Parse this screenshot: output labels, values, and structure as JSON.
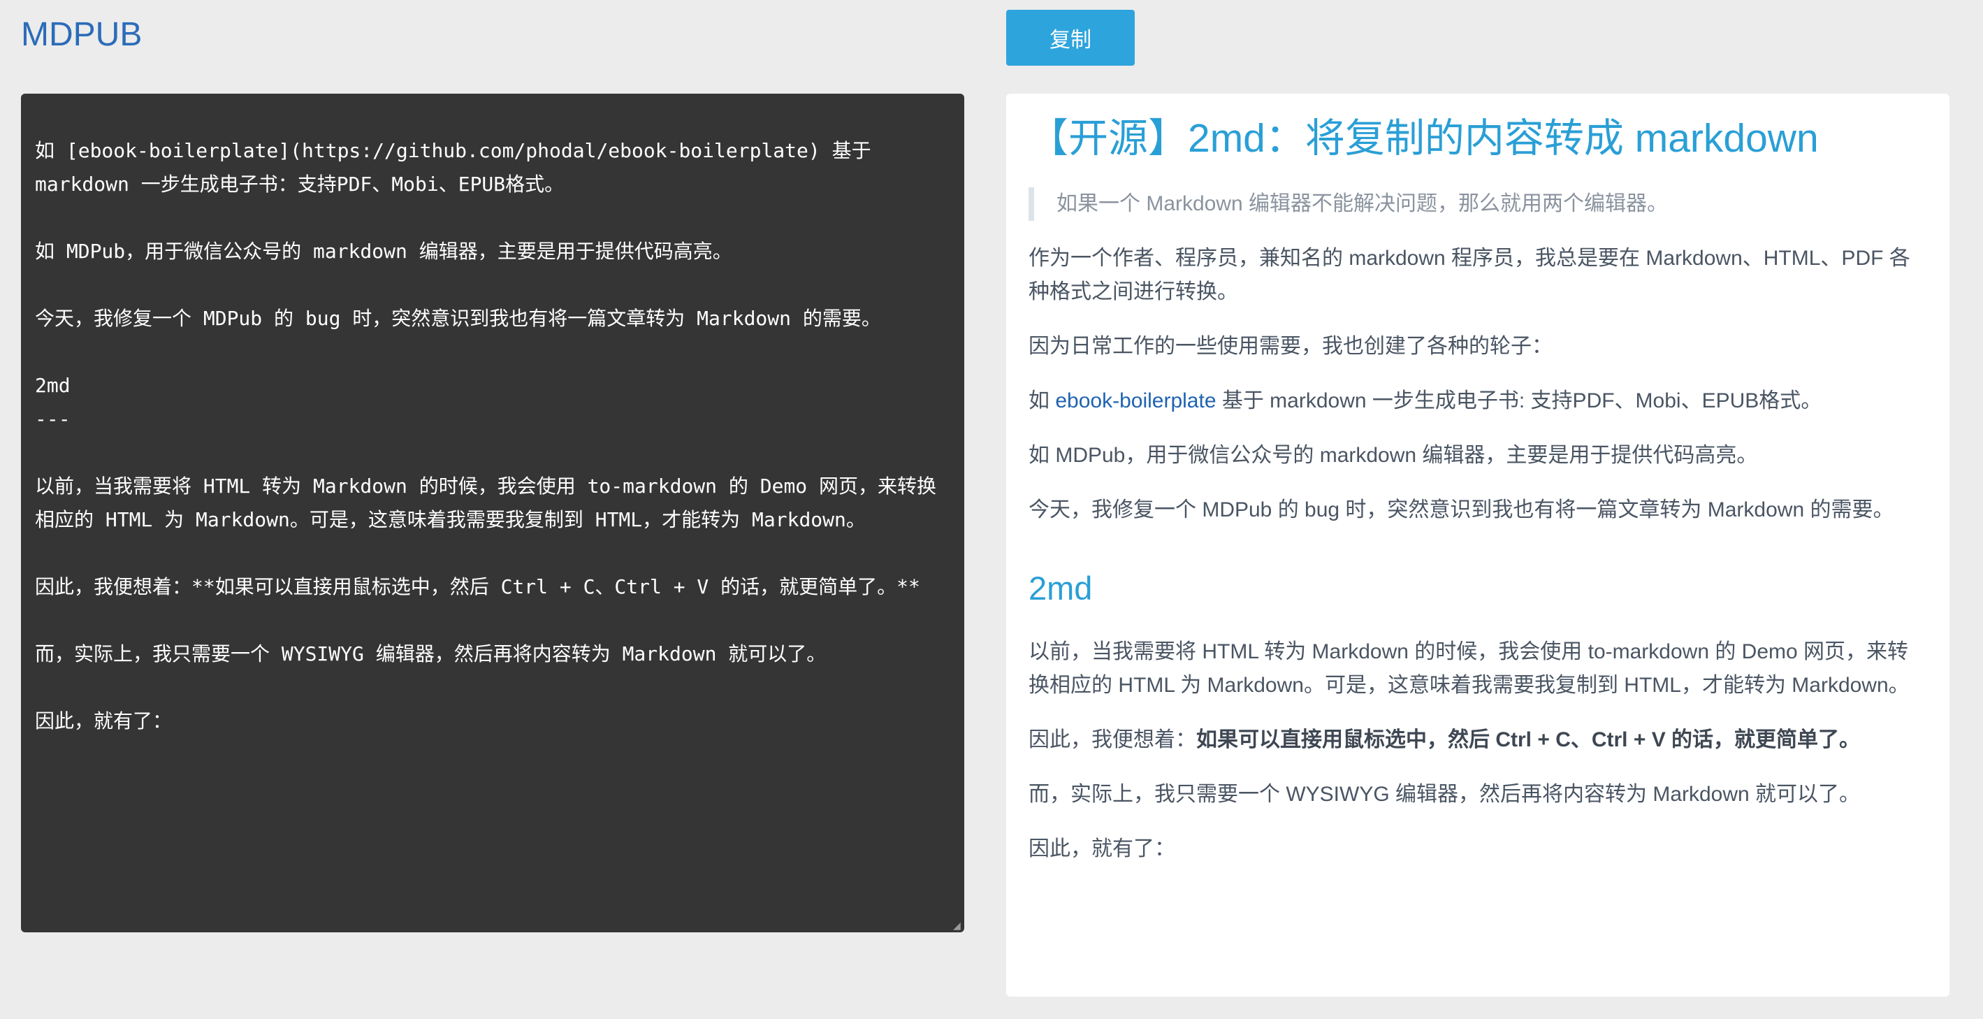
{
  "app": {
    "title": "MDPUB",
    "copy_button_label": "复制"
  },
  "editor": {
    "content": "因为日常工作的一些使用需要，我也创建了各种的轮子：\n\n如 [ebook-boilerplate](https://github.com/phodal/ebook-boilerplate) 基于 markdown 一步生成电子书：支持PDF、Mobi、EPUB格式。\n\n如 MDPub，用于微信公众号的 markdown 编辑器，主要是用于提供代码高亮。\n\n今天，我修复一个 MDPub 的 bug 时，突然意识到我也有将一篇文章转为 Markdown 的需要。\n\n2md\n---\n\n以前，当我需要将 HTML 转为 Markdown 的时候，我会使用 to-markdown 的 Demo 网页，来转换相应的 HTML 为 Markdown。可是，这意味着我需要我复制到 HTML，才能转为 Markdown。\n\n因此，我便想着：**如果可以直接用鼠标选中，然后 Ctrl + C、Ctrl + V 的话，就更简单了。**\n\n而，实际上，我只需要一个 WYSIWYG 编辑器，然后再将内容转为 Markdown 就可以了。\n\n因此，就有了："
  },
  "preview": {
    "h1": "【开源】2md：将复制的内容转成 markdown",
    "quote": "如果一个 Markdown 编辑器不能解决问题，那么就用两个编辑器。",
    "p1": "作为一个作者、程序员，兼知名的 markdown 程序员，我总是要在 Markdown、HTML、PDF 各种格式之间进行转换。",
    "p2": "因为日常工作的一些使用需要，我也创建了各种的轮子：",
    "p3_prefix": "如 ",
    "p3_link": "ebook-boilerplate",
    "p3_suffix": " 基于 markdown 一步生成电子书: 支持PDF、Mobi、EPUB格式。",
    "p4": "如 MDPub，用于微信公众号的 markdown 编辑器，主要是用于提供代码高亮。",
    "p5": "今天，我修复一个 MDPub 的 bug 时，突然意识到我也有将一篇文章转为 Markdown 的需要。",
    "h2": "2md",
    "p6": "以前，当我需要将 HTML 转为 Markdown 的时候，我会使用 to-markdown 的 Demo 网页，来转换相应的 HTML 为 Markdown。可是，这意味着我需要我复制到 HTML，才能转为 Markdown。",
    "p7_prefix": "因此，我便想着：",
    "p7_bold": "如果可以直接用鼠标选中，然后 Ctrl + C、Ctrl + V 的话，就更简单了。",
    "p8": "而，实际上，我只需要一个 WYSIWYG 编辑器，然后再将内容转为 Markdown 就可以了。",
    "p9": "因此，就有了："
  }
}
